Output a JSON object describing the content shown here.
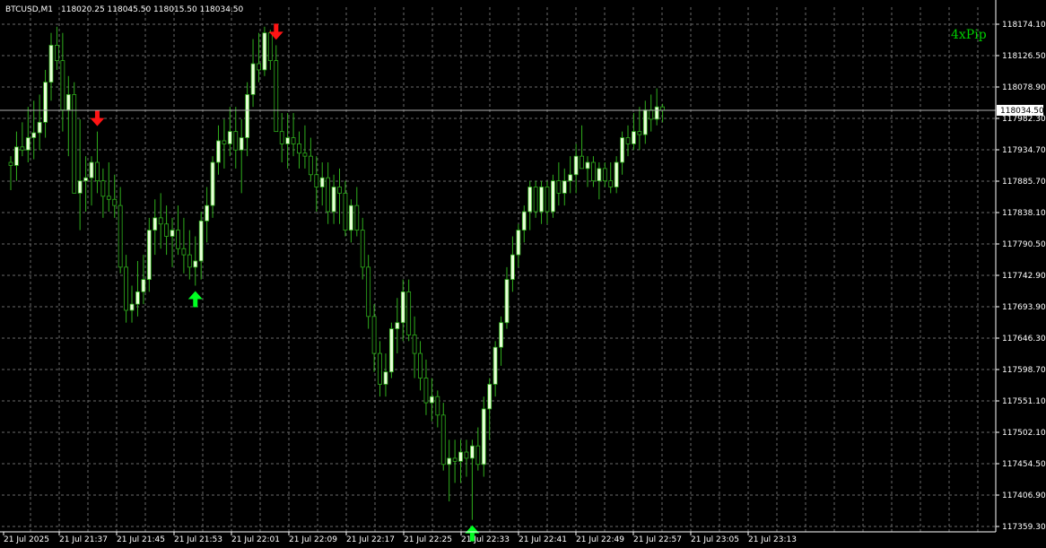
{
  "header": {
    "symbol": "BTCUSD,M1",
    "ohlc": "118020.25 118045.50 118015.50 118034.50"
  },
  "brand": "4xPip",
  "current_price_label": "118034.50",
  "colors": {
    "background": "#000000",
    "grid": "#6a6a6a",
    "bull_body": "#e8ffd8",
    "wick": "#2fae1c",
    "bear_body": "#000000",
    "buy_arrow": "#00ff22",
    "sell_arrow": "#ff1414",
    "price_line": "#b0b0b0"
  },
  "chart_data": {
    "type": "candlestick",
    "symbol": "BTCUSD",
    "timeframe": "M1",
    "y_ticks": [
      "118174.10",
      "118126.50",
      "118078.90",
      "117982.30",
      "117934.70",
      "117885.70",
      "117838.10",
      "117790.50",
      "117742.90",
      "117693.90",
      "117646.30",
      "117598.70",
      "117551.10",
      "117502.10",
      "117454.50",
      "117406.90",
      "117359.30"
    ],
    "x_ticks": [
      "21 Jul 2025",
      "21 Jul 21:37",
      "21 Jul 21:45",
      "21 Jul 21:53",
      "21 Jul 22:01",
      "21 Jul 22:09",
      "21 Jul 22:17",
      "21 Jul 22:25",
      "21 Jul 22:33",
      "21 Jul 22:41",
      "21 Jul 22:49",
      "21 Jul 22:57",
      "21 Jul 23:05",
      "21 Jul 23:13"
    ],
    "ylim": [
      117359.3,
      118174.1
    ],
    "current_price": 118034.5,
    "candles": [
      [
        117950,
        117960,
        117905,
        117945
      ],
      [
        117945,
        118000,
        117920,
        117975
      ],
      [
        117975,
        118015,
        117960,
        117970
      ],
      [
        117970,
        118040,
        117950,
        117990
      ],
      [
        117990,
        118050,
        117955,
        117998
      ],
      [
        117998,
        118060,
        117970,
        118015
      ],
      [
        118015,
        118100,
        117990,
        118080
      ],
      [
        118080,
        118160,
        118050,
        118140
      ],
      [
        118140,
        118170,
        118100,
        118115
      ],
      [
        118115,
        118160,
        118000,
        118035
      ],
      [
        118035,
        118090,
        117960,
        118060
      ],
      [
        118060,
        118080,
        117950,
        117900
      ],
      [
        117900,
        118020,
        117840,
        117920
      ],
      [
        117920,
        117960,
        117870,
        117925
      ],
      [
        117925,
        117960,
        117880,
        117950
      ],
      [
        117950,
        118000,
        117900,
        117920
      ],
      [
        117920,
        117940,
        117860,
        117895
      ],
      [
        117895,
        117950,
        117870,
        117890
      ],
      [
        117890,
        117930,
        117860,
        117880
      ],
      [
        117880,
        117910,
        117770,
        117780
      ],
      [
        117780,
        117800,
        117690,
        117710
      ],
      [
        117710,
        117750,
        117690,
        117720
      ],
      [
        117720,
        117790,
        117700,
        117740
      ],
      [
        117740,
        117800,
        117720,
        117760
      ],
      [
        117760,
        117860,
        117740,
        117840
      ],
      [
        117840,
        117890,
        117800,
        117860
      ],
      [
        117860,
        117900,
        117810,
        117850
      ],
      [
        117850,
        117880,
        117800,
        117830
      ],
      [
        117830,
        117860,
        117780,
        117840
      ],
      [
        117840,
        117880,
        117800,
        117810
      ],
      [
        117810,
        117860,
        117770,
        117800
      ],
      [
        117800,
        117840,
        117760,
        117780
      ],
      [
        117780,
        117830,
        117750,
        117790
      ],
      [
        117790,
        117870,
        117760,
        117855
      ],
      [
        117855,
        117910,
        117820,
        117880
      ],
      [
        117880,
        117960,
        117860,
        117950
      ],
      [
        117950,
        118010,
        117930,
        117985
      ],
      [
        117985,
        118020,
        117940,
        117980
      ],
      [
        117980,
        118040,
        117960,
        118000
      ],
      [
        118000,
        118040,
        117940,
        117970
      ],
      [
        117970,
        118020,
        117900,
        117990
      ],
      [
        117990,
        118080,
        117960,
        118060
      ],
      [
        118060,
        118150,
        118040,
        118110
      ],
      [
        118110,
        118160,
        118080,
        118100
      ],
      [
        118100,
        118170,
        118090,
        118160
      ],
      [
        118160,
        118165,
        118100,
        118115
      ],
      [
        118115,
        118140,
        118010,
        118000
      ],
      [
        118000,
        118030,
        117950,
        117980
      ],
      [
        117980,
        118030,
        117940,
        117990
      ],
      [
        117990,
        118030,
        117960,
        117980
      ],
      [
        117980,
        118000,
        117940,
        117965
      ],
      [
        117965,
        118010,
        117940,
        117960
      ],
      [
        117960,
        117990,
        117920,
        117930
      ],
      [
        117930,
        117960,
        117870,
        117910
      ],
      [
        117910,
        117950,
        117880,
        117925
      ],
      [
        117925,
        117950,
        117850,
        117870
      ],
      [
        117870,
        117930,
        117850,
        117910
      ],
      [
        117910,
        117940,
        117850,
        117900
      ],
      [
        117900,
        117920,
        117830,
        117840
      ],
      [
        117840,
        117890,
        117820,
        117880
      ],
      [
        117880,
        117910,
        117830,
        117840
      ],
      [
        117840,
        117860,
        117760,
        117780
      ],
      [
        117780,
        117800,
        117680,
        117700
      ],
      [
        117700,
        117720,
        117610,
        117640
      ],
      [
        117640,
        117660,
        117570,
        117590
      ],
      [
        117590,
        117640,
        117570,
        117610
      ],
      [
        117610,
        117690,
        117600,
        117680
      ],
      [
        117680,
        117730,
        117640,
        117690
      ],
      [
        117690,
        117760,
        117660,
        117740
      ],
      [
        117740,
        117760,
        117660,
        117670
      ],
      [
        117670,
        117700,
        117600,
        117640
      ],
      [
        117640,
        117660,
        117580,
        117600
      ],
      [
        117600,
        117630,
        117540,
        117560
      ],
      [
        117560,
        117600,
        117530,
        117570
      ],
      [
        117570,
        117580,
        117520,
        117540
      ],
      [
        117540,
        117560,
        117450,
        117460
      ],
      [
        117460,
        117500,
        117400,
        117470
      ],
      [
        117470,
        117500,
        117430,
        117465
      ],
      [
        117465,
        117500,
        117430,
        117480
      ],
      [
        117480,
        117500,
        117440,
        117470
      ],
      [
        117470,
        117500,
        117370,
        117490
      ],
      [
        117490,
        117520,
        117450,
        117460
      ],
      [
        117460,
        117570,
        117440,
        117550
      ],
      [
        117550,
        117600,
        117500,
        117590
      ],
      [
        117590,
        117660,
        117570,
        117650
      ],
      [
        117650,
        117700,
        117620,
        117690
      ],
      [
        117690,
        117780,
        117680,
        117760
      ],
      [
        117760,
        117830,
        117740,
        117800
      ],
      [
        117800,
        117850,
        117780,
        117840
      ],
      [
        117840,
        117880,
        117820,
        117870
      ],
      [
        117870,
        117920,
        117840,
        117910
      ],
      [
        117910,
        117920,
        117860,
        117870
      ],
      [
        117870,
        117920,
        117850,
        117910
      ],
      [
        117910,
        117920,
        117850,
        117870
      ],
      [
        117870,
        117930,
        117860,
        117920
      ],
      [
        117920,
        117950,
        117880,
        117900
      ],
      [
        117900,
        117940,
        117880,
        117920
      ],
      [
        117920,
        117960,
        117900,
        117930
      ],
      [
        117930,
        117980,
        117900,
        117960
      ],
      [
        117960,
        118010,
        117940,
        117940
      ],
      [
        117940,
        117960,
        117910,
        117950
      ],
      [
        117950,
        117960,
        117910,
        117920
      ],
      [
        117920,
        117950,
        117890,
        117940
      ],
      [
        117940,
        117950,
        117910,
        117920
      ],
      [
        117920,
        117950,
        117900,
        117910
      ],
      [
        117910,
        117960,
        117900,
        117950
      ],
      [
        117950,
        118000,
        117930,
        117990
      ],
      [
        117990,
        118010,
        117960,
        117980
      ],
      [
        117980,
        118030,
        117970,
        118000
      ],
      [
        118000,
        118040,
        117970,
        117995
      ],
      [
        117995,
        118050,
        117980,
        118035
      ],
      [
        118035,
        118060,
        118000,
        118020
      ],
      [
        118020,
        118070,
        118010,
        118040
      ],
      [
        118040,
        118045,
        118015,
        118034.5
      ]
    ],
    "signals": [
      {
        "type": "sell",
        "candle": 15
      },
      {
        "type": "buy",
        "candle": 32
      },
      {
        "type": "sell",
        "candle": 46
      },
      {
        "type": "buy",
        "candle": 80
      }
    ]
  }
}
